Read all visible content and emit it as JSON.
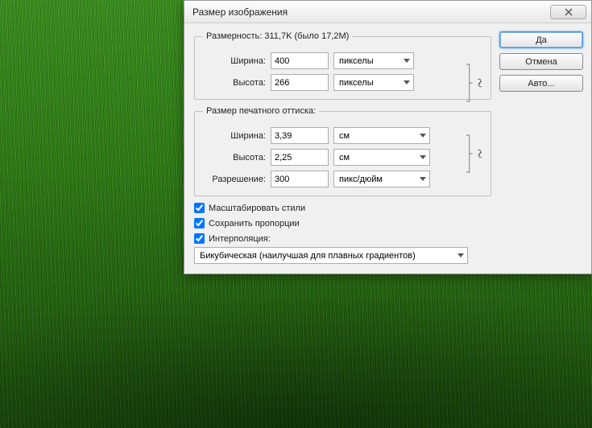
{
  "dialog": {
    "title": "Размер изображения",
    "buttons": {
      "ok": "Да",
      "cancel": "Отмена",
      "auto": "Авто..."
    },
    "pixel_dimensions": {
      "legend": "Размерность:   311,7K (было 17,2M)",
      "width_label": "Ширина:",
      "width_value": "400",
      "width_unit": "пикселы",
      "height_label": "Высота:",
      "height_value": "266",
      "height_unit": "пикселы"
    },
    "document_size": {
      "legend": "Размер печатного оттиска:",
      "width_label": "Ширина:",
      "width_value": "3,39",
      "width_unit": "см",
      "height_label": "Высота:",
      "height_value": "2,25",
      "height_unit": "см",
      "resolution_label": "Разрешение:",
      "resolution_value": "300",
      "resolution_unit": "пикс/дюйм"
    },
    "options": {
      "scale_styles": "Масштабировать стили",
      "constrain": "Сохранить пропорции",
      "resample": "Интерполяция:",
      "method": "Бикубическая (наилучшая для плавных градиентов)"
    }
  }
}
